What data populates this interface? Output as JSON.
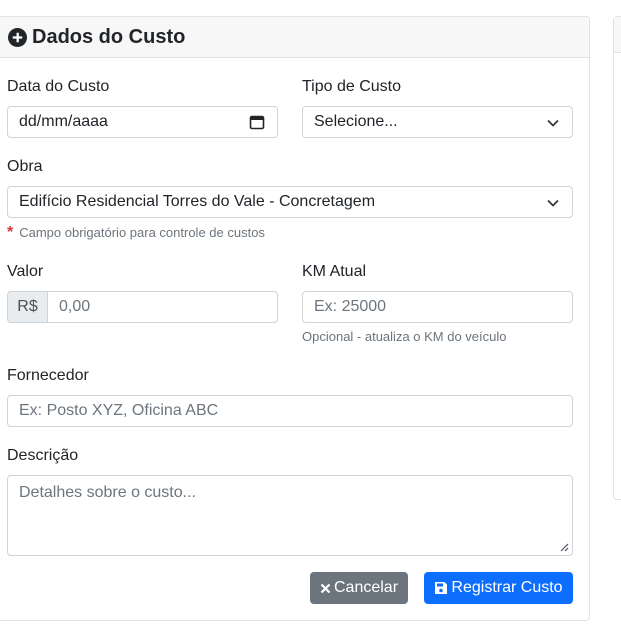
{
  "header": {
    "title": "Dados do Custo",
    "icon": "plus-circle-icon"
  },
  "fields": {
    "data": {
      "label": "Data do Custo",
      "value": "dd/mm/aaaa"
    },
    "tipo": {
      "label": "Tipo de Custo",
      "value": "Selecione..."
    },
    "obra": {
      "label": "Obra",
      "value": "Edifício Residencial Torres do Vale - Concretagem",
      "hint": "Campo obrigatório para controle de custos"
    },
    "valor": {
      "label": "Valor",
      "prefix": "R$",
      "placeholder": "0,00"
    },
    "km": {
      "label": "KM Atual",
      "placeholder": "Ex: 25000",
      "hint": "Opcional - atualiza o KM do veículo"
    },
    "fornecedor": {
      "label": "Fornecedor",
      "placeholder": "Ex: Posto XYZ, Oficina ABC"
    },
    "descricao": {
      "label": "Descrição",
      "placeholder": "Detalhes sobre o custo..."
    }
  },
  "actions": {
    "cancel_label": "Cancelar",
    "save_label": "Registrar Custo"
  },
  "colors": {
    "primary": "#0d6efd",
    "secondary": "#6c757d",
    "danger": "#dc3545"
  }
}
